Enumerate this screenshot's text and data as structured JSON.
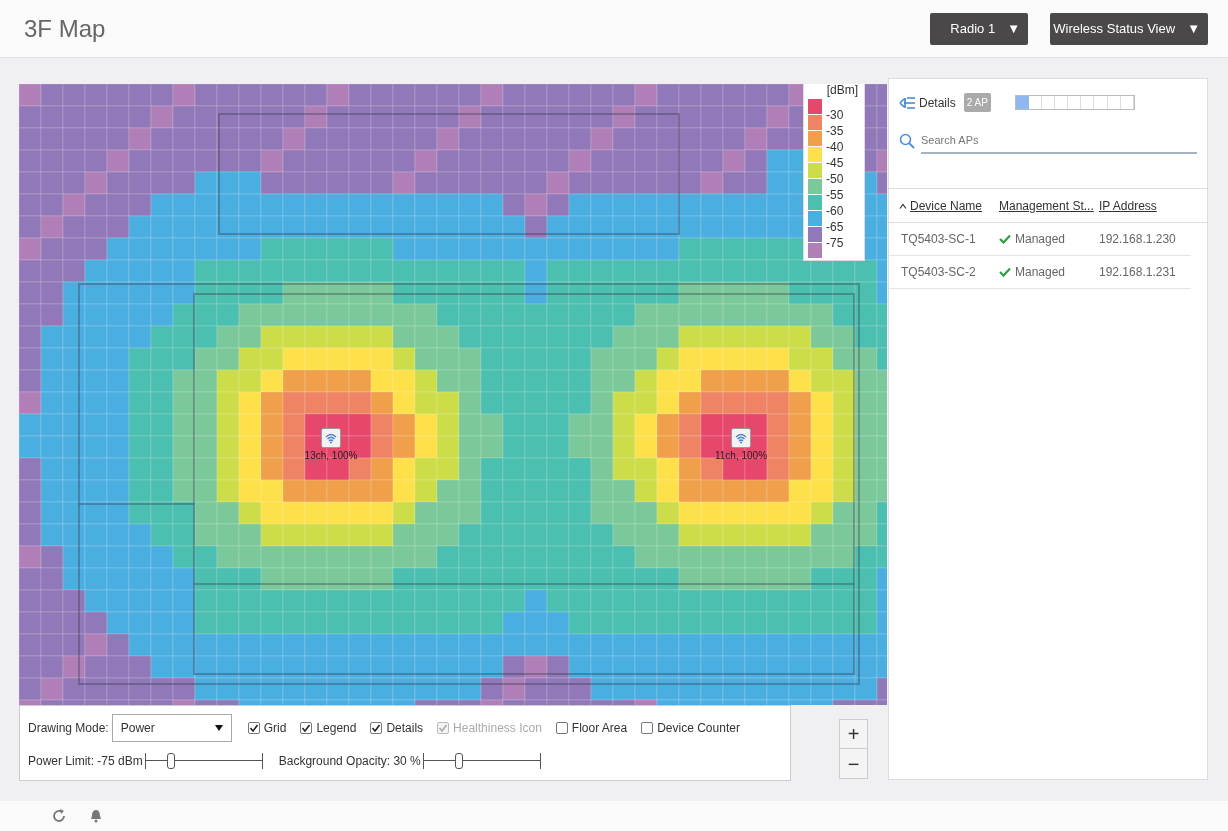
{
  "header": {
    "title": "3F Map",
    "dropdowns": [
      {
        "label": "Radio 1",
        "caret": "▼"
      },
      {
        "label": "Wireless Status View",
        "caret": "▼"
      }
    ]
  },
  "map": {
    "legend": {
      "unit": "[dBm]",
      "items": [
        {
          "label": "-30",
          "color": "#e8476c"
        },
        {
          "label": "-35",
          "color": "#ef8465"
        },
        {
          "label": "-40",
          "color": "#f0a04a"
        },
        {
          "label": "-45",
          "color": "#fde04a"
        },
        {
          "label": "-50",
          "color": "#cddd4a"
        },
        {
          "label": "-55",
          "color": "#7bc99a"
        },
        {
          "label": "-60",
          "color": "#4bbfb0"
        },
        {
          "label": "-65",
          "color": "#4aaee0"
        },
        {
          "label": "-75",
          "color": "#9178b8"
        },
        {
          "color": "#b07fb8"
        }
      ]
    },
    "access_points": [
      {
        "label": "13ch, 100%"
      },
      {
        "label": "11ch, 100%"
      }
    ],
    "zoom": {
      "in": "+",
      "out": "−"
    }
  },
  "options": {
    "drawing_mode_label": "Drawing Mode:",
    "drawing_mode": "Power",
    "checkboxes": [
      {
        "label": "Grid",
        "checked": true,
        "disabled": false
      },
      {
        "label": "Legend",
        "checked": true,
        "disabled": false
      },
      {
        "label": "Details",
        "checked": true,
        "disabled": false
      },
      {
        "label": "Healthiness Icon",
        "checked": true,
        "disabled": true
      },
      {
        "label": "Floor Area",
        "checked": false,
        "disabled": false
      },
      {
        "label": "Device Counter",
        "checked": false,
        "disabled": false
      }
    ],
    "sliders": [
      {
        "label": "Power Limit: -75 dBm",
        "level": 0.22
      },
      {
        "label": "Background Opacity: 30 %",
        "level": 0.3
      }
    ]
  },
  "details": {
    "title": "Details",
    "badge": "2 AP",
    "meter": {
      "level": 0.11
    },
    "search": {
      "placeholder": "Search APs"
    },
    "columns": [
      {
        "label": "Device Name",
        "sorted": true
      },
      {
        "label": "Management St...",
        "sorted": false
      },
      {
        "label": "IP Address",
        "sorted": false
      }
    ],
    "rows": [
      {
        "name": "TQ5403-SC-1",
        "status": "Managed",
        "ip": "192.168.1.230"
      },
      {
        "name": "TQ5403-SC-2",
        "status": "Managed",
        "ip": "192.168.1.231"
      }
    ]
  }
}
